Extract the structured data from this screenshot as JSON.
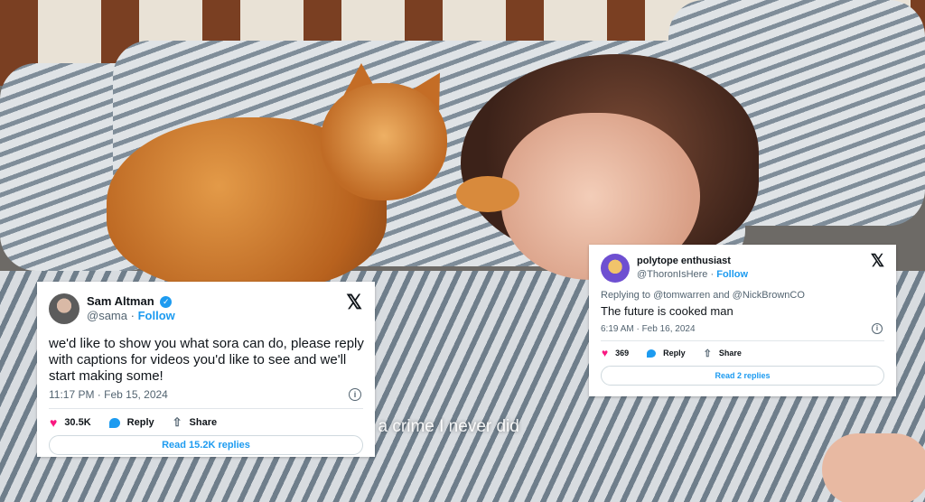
{
  "video": {
    "caption_fragment": "f a crime I never did"
  },
  "tweet_left": {
    "name": "Sam Altman",
    "handle": "@sama",
    "separator": "·",
    "follow_label": "Follow",
    "text": "we'd like to show you what sora can do, please reply with captions for videos you'd like to see and we'll start making some!",
    "time": "11:17 PM · Feb 15, 2024",
    "likes": "30.5K",
    "reply_label": "Reply",
    "share_label": "Share",
    "read_replies_label": "Read 15.2K replies",
    "icons": [
      "verified-badge-icon",
      "x-logo-icon",
      "info-icon",
      "heart-icon",
      "reply-icon",
      "share-icon"
    ],
    "x_glyph": "𝕏",
    "info_glyph": "i",
    "heart_glyph": "♥",
    "share_glyph": "⇧",
    "check_glyph": "✓"
  },
  "tweet_right": {
    "name": "polytope enthusiast",
    "handle": "@ThoronIsHere",
    "separator": "·",
    "follow_label": "Follow",
    "replying_to": "Replying to @tomwarren and @NickBrownCO",
    "text": "The future is cooked man",
    "time": "6:19 AM · Feb 16, 2024",
    "likes": "369",
    "reply_label": "Reply",
    "share_label": "Share",
    "read_replies_label": "Read 2 replies",
    "x_glyph": "𝕏",
    "info_glyph": "i",
    "heart_glyph": "♥",
    "share_glyph": "⇧"
  },
  "colors": {
    "x_blue": "#1d9bf0",
    "like_pink": "#f91880",
    "text_dark": "#0f1419",
    "text_gray": "#536471"
  }
}
